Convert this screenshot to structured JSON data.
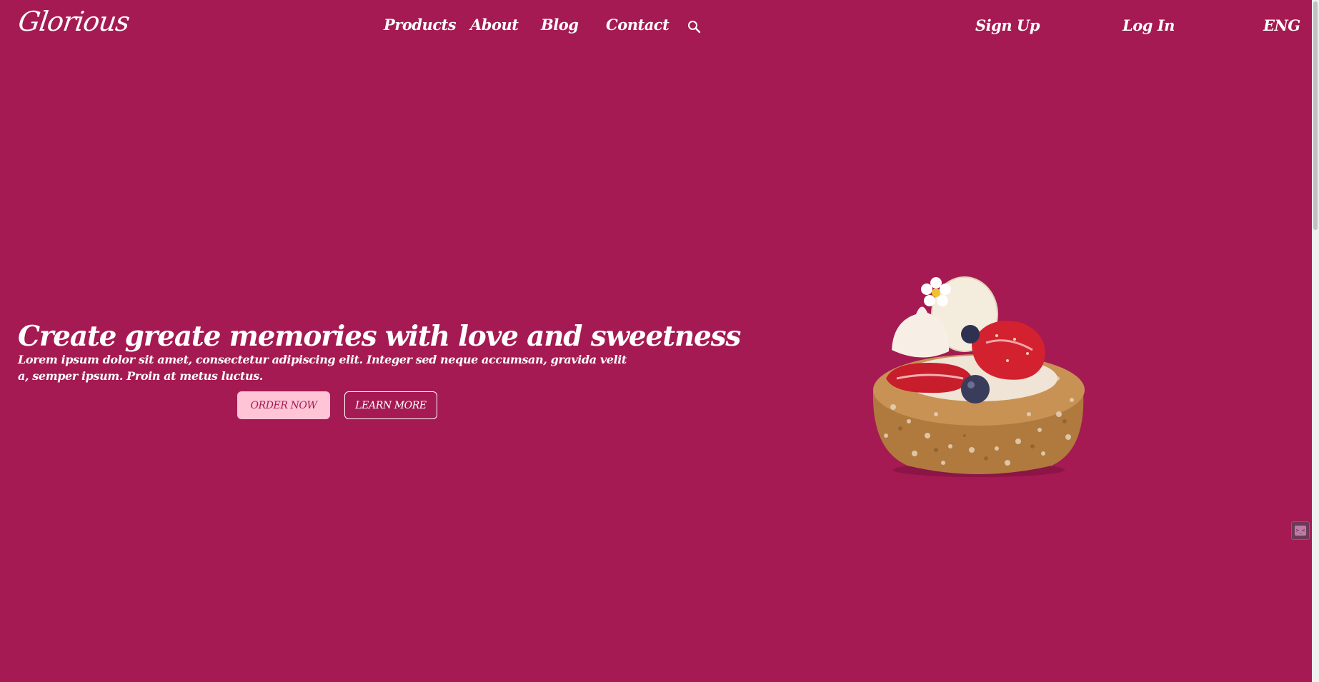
{
  "brand": {
    "logo_text": "Glorious"
  },
  "nav": {
    "products": "Products",
    "about": "About",
    "blog": "Blog",
    "contact": "Contact",
    "search_icon": "search-icon",
    "sign_up": "Sign Up",
    "log_in": "Log In",
    "language": "ENG"
  },
  "hero": {
    "title": "Create greate memories with love and sweetness",
    "description": "Lorem ipsum dolor sit amet, consectetur adipiscing elit. Integer sed neque accumsan, gravida velit a, semper ipsum. Proin at metus luctus.",
    "order_button": "ORDER NOW",
    "learn_button": "LEARN MORE"
  },
  "widget": {
    "label": ">_<"
  },
  "colors": {
    "background": "#a51a52",
    "order_button_bg": "#ffc4d6",
    "text": "#ffffff"
  }
}
